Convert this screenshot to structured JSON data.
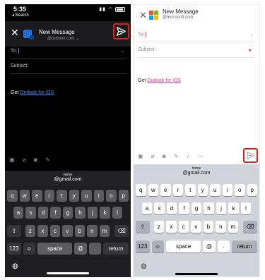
{
  "dark_screen": {
    "status": {
      "time": "5:35",
      "back_label": "◂ Search"
    },
    "header": {
      "title": "New Message",
      "account": "@outlook.com"
    },
    "fields": {
      "to_label": "To:",
      "subject_label": "Subject:"
    },
    "body": {
      "prefix": "Get ",
      "link_text": "Outlook for iOS"
    },
    "suggestion": {
      "label": "home",
      "value": "@gmail.com"
    },
    "keyboard": {
      "row1": [
        "q",
        "w",
        "e",
        "r",
        "t",
        "y",
        "u",
        "i",
        "o",
        "p"
      ],
      "row2": [
        "a",
        "s",
        "d",
        "f",
        "g",
        "h",
        "j",
        "k",
        "l"
      ],
      "row3": [
        "z",
        "x",
        "c",
        "v",
        "b",
        "n",
        "m"
      ],
      "num_key": "123",
      "space_key": "space",
      "at_key": "@",
      "dot_key": ".",
      "return_key": "return"
    }
  },
  "light_screen": {
    "header": {
      "title": "New Message",
      "account": "@microsoft.com"
    },
    "fields": {
      "to_label": "To:",
      "subject_label": "Subject:"
    },
    "body": {
      "prefix": "Get ",
      "link_text": "Outlook for iOS"
    },
    "suggestion": {
      "label": "home",
      "value": "@gmail.com"
    },
    "keyboard": {
      "row1": [
        "q",
        "w",
        "e",
        "r",
        "t",
        "y",
        "u",
        "i",
        "o",
        "p"
      ],
      "row2": [
        "a",
        "s",
        "d",
        "f",
        "g",
        "h",
        "j",
        "k",
        "l"
      ],
      "row3": [
        "z",
        "x",
        "c",
        "v",
        "b",
        "n",
        "m"
      ],
      "num_key": "123",
      "space_key": "space",
      "at_key": "@",
      "dot_key": ".",
      "return_key": "return"
    }
  },
  "colors": {
    "highlight_box": "#e01e1e",
    "dark_link": "#3b8cff",
    "light_link": "#d43b8a"
  }
}
